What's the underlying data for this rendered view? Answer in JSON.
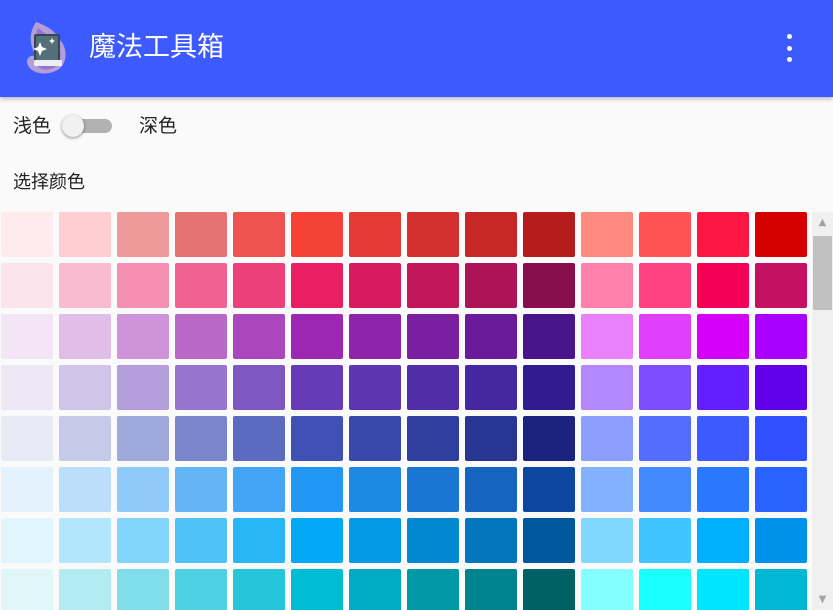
{
  "app": {
    "title": "魔法工具箱"
  },
  "theme": {
    "light_label": "浅色",
    "dark_label": "深色",
    "dark_enabled": false
  },
  "picker": {
    "label": "选择颜色",
    "rows": [
      [
        "#ffebee",
        "#ffcdd2",
        "#ef9a9a",
        "#e57373",
        "#ef5350",
        "#f44336",
        "#e53935",
        "#d32f2f",
        "#c62828",
        "#b71c1c",
        "#ff8a80",
        "#ff5252",
        "#ff1744",
        "#d50000"
      ],
      [
        "#fce4ec",
        "#f8bbd0",
        "#f48fb1",
        "#f06292",
        "#ec407a",
        "#e91e63",
        "#d81b60",
        "#c2185b",
        "#ad1457",
        "#880e4f",
        "#ff80ab",
        "#ff4081",
        "#f50057",
        "#c51162"
      ],
      [
        "#f3e5f5",
        "#e1bee7",
        "#ce93d8",
        "#ba68c8",
        "#ab47bc",
        "#9c27b0",
        "#8e24aa",
        "#7b1fa2",
        "#6a1b9a",
        "#4a148c",
        "#ea80fc",
        "#e040fb",
        "#d500f9",
        "#aa00ff"
      ],
      [
        "#ede7f6",
        "#d1c4e9",
        "#b39ddb",
        "#9575cd",
        "#7e57c2",
        "#673ab7",
        "#5e35b1",
        "#512da8",
        "#4527a0",
        "#311b92",
        "#b388ff",
        "#7c4dff",
        "#651fff",
        "#6200ea"
      ],
      [
        "#e8eaf6",
        "#c5cae9",
        "#9fa8da",
        "#7986cb",
        "#5c6bc0",
        "#3f51b5",
        "#3949ab",
        "#303f9f",
        "#283593",
        "#1a237e",
        "#8c9eff",
        "#536dfe",
        "#3d5afe",
        "#304ffe"
      ],
      [
        "#e3f2fd",
        "#bbdefb",
        "#90caf9",
        "#64b5f6",
        "#42a5f5",
        "#2196f3",
        "#1e88e5",
        "#1976d2",
        "#1565c0",
        "#0d47a1",
        "#82b1ff",
        "#448aff",
        "#2979ff",
        "#2962ff"
      ],
      [
        "#e1f5fe",
        "#b3e5fc",
        "#81d4fa",
        "#4fc3f7",
        "#29b6f6",
        "#03a9f4",
        "#039be5",
        "#0288d1",
        "#0277bd",
        "#01579b",
        "#80d8ff",
        "#40c4ff",
        "#00b0ff",
        "#0091ea"
      ],
      [
        "#e0f7fa",
        "#b2ebf2",
        "#80deea",
        "#4dd0e1",
        "#26c6da",
        "#00bcd4",
        "#00acc1",
        "#0097a7",
        "#00838f",
        "#006064",
        "#84ffff",
        "#18ffff",
        "#00e5ff",
        "#00b8d4"
      ]
    ]
  },
  "colors": {
    "appbar": "#3d5afe",
    "background": "#fafafa"
  },
  "icons": {
    "app": "magic-hat-book-icon",
    "menu": "more-vert-icon"
  }
}
